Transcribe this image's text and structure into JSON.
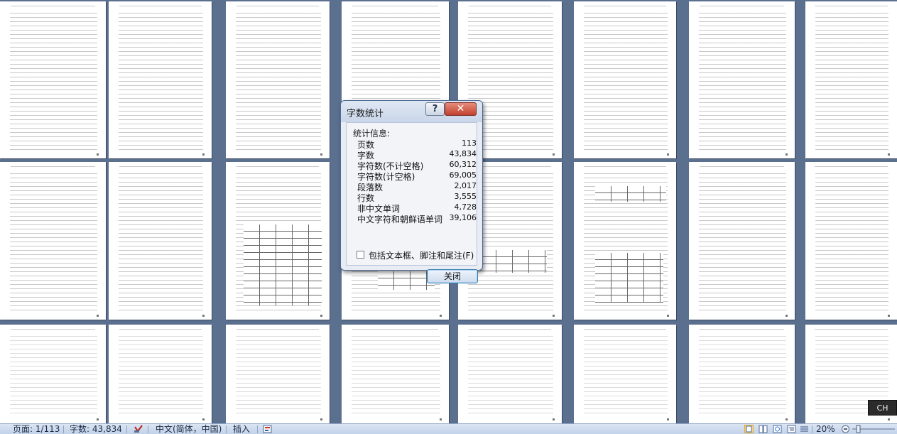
{
  "dialog": {
    "title": "字数统计",
    "help_label": "?",
    "close_glyph": "✕",
    "section_label": "统计信息:",
    "stats": [
      {
        "label": "页数",
        "value": "113"
      },
      {
        "label": "字数",
        "value": "43,834"
      },
      {
        "label": "字符数(不计空格)",
        "value": "60,312"
      },
      {
        "label": "字符数(计空格)",
        "value": "69,005"
      },
      {
        "label": "段落数",
        "value": "2,017"
      },
      {
        "label": "行数",
        "value": "3,555"
      },
      {
        "label": "非中文单词",
        "value": "4,728"
      },
      {
        "label": "中文字符和朝鲜语单词",
        "value": "39,106"
      }
    ],
    "checkbox_label": "包括文本框、脚注和尾注(F)",
    "checkbox_checked": false,
    "ok_label": "关闭"
  },
  "highlight_color": "#e42c36",
  "status": {
    "page": "页面: 1/113",
    "words": "字数: 43,834",
    "language": "中文(简体，中国)",
    "mode": "插入",
    "zoom": "20%"
  },
  "ime_label": "CH",
  "icons": [
    "spellcheck-icon",
    "macro-icon",
    "view-print-layout-icon",
    "view-full-screen-icon",
    "view-web-icon",
    "view-outline-icon",
    "view-draft-icon",
    "zoom-out-icon",
    "zoom-slider-icon"
  ]
}
